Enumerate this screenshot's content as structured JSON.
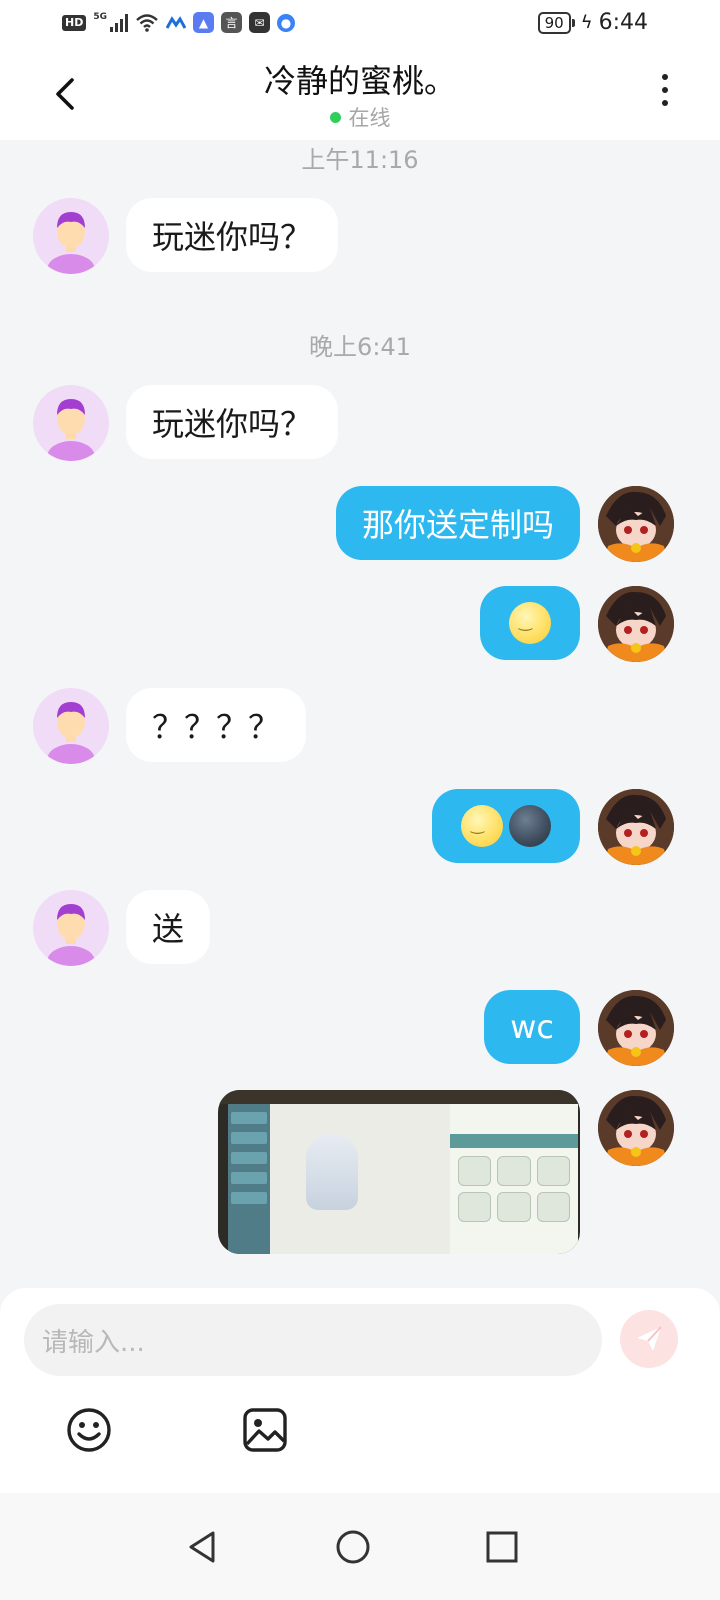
{
  "status_bar": {
    "hd": "HD",
    "network": "5G",
    "battery": "90",
    "time": "6:44"
  },
  "header": {
    "title": "冷静的蜜桃。",
    "presence": "在线"
  },
  "chat": {
    "timestamps": [
      "上午11:16",
      "晚上6:41"
    ],
    "messages": [
      {
        "from": "them",
        "text": "玩迷你吗？"
      },
      {
        "from": "them",
        "text": "玩迷你吗？"
      },
      {
        "from": "me",
        "text": "那你送定制吗"
      },
      {
        "from": "me",
        "emoji": [
          "full-moon-face"
        ]
      },
      {
        "from": "them",
        "text": "？？？？"
      },
      {
        "from": "me",
        "emoji": [
          "full-moon-face",
          "new-moon-face"
        ]
      },
      {
        "from": "them",
        "text": "送"
      },
      {
        "from": "me",
        "text": "wc"
      },
      {
        "from": "me",
        "image": "game-screenshot"
      }
    ]
  },
  "composer": {
    "placeholder": "请输入...",
    "icons": [
      "smiley-icon",
      "image-icon",
      "send-icon"
    ]
  },
  "colors": {
    "outgoing_bubble": "#2eb8f0",
    "incoming_bubble": "#ffffff",
    "online_dot": "#2ecf5a",
    "send_button": "#fde2e2"
  }
}
